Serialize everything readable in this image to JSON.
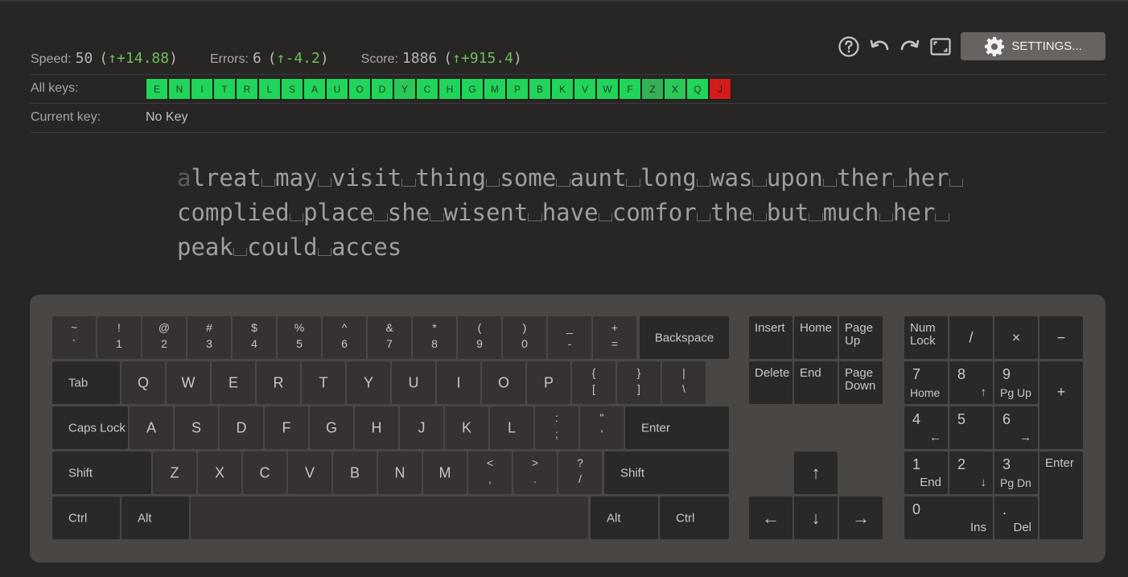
{
  "toolbar": {
    "settings_label": "SETTINGS..."
  },
  "stats": {
    "speed": {
      "label": "Speed:",
      "value": "50",
      "open": "(",
      "delta": "↑+14.88",
      "close": ")"
    },
    "errors": {
      "label": "Errors:",
      "value": "6",
      "open": "(",
      "delta": "↑-4.2",
      "close": ")"
    },
    "score": {
      "label": "Score:",
      "value": "1886",
      "open": "(",
      "delta": "↑+915.4",
      "close": ")"
    }
  },
  "all_keys": {
    "label": "All keys:",
    "keys": [
      {
        "k": "E",
        "color": "#21d45a"
      },
      {
        "k": "N",
        "color": "#21d45a"
      },
      {
        "k": "I",
        "color": "#21d45a"
      },
      {
        "k": "T",
        "color": "#21d45a"
      },
      {
        "k": "R",
        "color": "#21d45a"
      },
      {
        "k": "L",
        "color": "#21d45a"
      },
      {
        "k": "S",
        "color": "#21d45a"
      },
      {
        "k": "A",
        "color": "#21d45a"
      },
      {
        "k": "U",
        "color": "#21d45a"
      },
      {
        "k": "O",
        "color": "#21d45a"
      },
      {
        "k": "D",
        "color": "#21d45a"
      },
      {
        "k": "Y",
        "color": "#2bc757"
      },
      {
        "k": "C",
        "color": "#21d45a"
      },
      {
        "k": "H",
        "color": "#21d45a"
      },
      {
        "k": "G",
        "color": "#21d45a"
      },
      {
        "k": "M",
        "color": "#21d45a"
      },
      {
        "k": "P",
        "color": "#21d45a"
      },
      {
        "k": "B",
        "color": "#21d45a"
      },
      {
        "k": "K",
        "color": "#21d45a"
      },
      {
        "k": "V",
        "color": "#21d45a"
      },
      {
        "k": "W",
        "color": "#21d45a"
      },
      {
        "k": "F",
        "color": "#21d45a"
      },
      {
        "k": "Z",
        "color": "#34b055"
      },
      {
        "k": "X",
        "color": "#2bc757"
      },
      {
        "k": "Q",
        "color": "#21d45a"
      },
      {
        "k": "J",
        "color": "#d21c1c"
      }
    ]
  },
  "current_key": {
    "label": "Current key:",
    "value": "No Key"
  },
  "text": {
    "cursor_char": "a",
    "lines": [
      [
        "lreat",
        "may",
        "visit",
        "thing",
        "some",
        "aunt",
        "long",
        "was",
        "upon",
        "ther",
        "her",
        ""
      ],
      [
        "complied",
        "place",
        "she",
        "wisent",
        "have",
        "comfor",
        "the",
        "but",
        "much",
        "her",
        ""
      ],
      [
        "peak",
        "could",
        "acces"
      ]
    ]
  },
  "keyboard": {
    "row1": [
      [
        "~",
        "`"
      ],
      [
        "!",
        "1"
      ],
      [
        "@",
        "2"
      ],
      [
        "#",
        "3"
      ],
      [
        "$",
        "4"
      ],
      [
        "%",
        "5"
      ],
      [
        "^",
        "6"
      ],
      [
        "&",
        "7"
      ],
      [
        "*",
        "8"
      ],
      [
        "(",
        "9"
      ],
      [
        ")",
        "0"
      ],
      [
        "_",
        "-"
      ],
      [
        "+",
        "="
      ]
    ],
    "backspace": "Backspace",
    "tab": "Tab",
    "row2": [
      "Q",
      "W",
      "E",
      "R",
      "T",
      "Y",
      "U",
      "I",
      "O",
      "P"
    ],
    "row2_sym": [
      [
        "{",
        "["
      ],
      [
        "}",
        "]"
      ],
      [
        "|",
        "\\"
      ]
    ],
    "caps": "Caps Lock",
    "row3": [
      "A",
      "S",
      "D",
      "F",
      "G",
      "H",
      "J",
      "K",
      "L"
    ],
    "row3_sym": [
      [
        ":",
        ";"
      ],
      [
        "\"",
        "'"
      ]
    ],
    "enter": "Enter",
    "shift_left": "Shift",
    "row4": [
      "Z",
      "X",
      "C",
      "V",
      "B",
      "N",
      "M"
    ],
    "row4_sym": [
      [
        "<",
        ","
      ],
      [
        ">",
        "."
      ],
      [
        "?",
        "/"
      ]
    ],
    "shift_right": "Shift",
    "ctrl_left": "Ctrl",
    "alt_left": "Alt",
    "alt_right": "Alt",
    "ctrl_right": "Ctrl",
    "nav": {
      "insert": "Insert",
      "home": "Home",
      "page_up": "Page Up",
      "delete": "Delete",
      "end": "End",
      "page_down": "Page Down"
    },
    "arrows": {
      "up": "↑",
      "left": "←",
      "down": "↓",
      "right": "→"
    },
    "numpad": {
      "numlock": "Num Lock",
      "divide": "/",
      "multiply": "×",
      "minus": "−",
      "plus": "+",
      "n7": "7",
      "n7s": "Home",
      "n8": "8",
      "n8s": "↑",
      "n9": "9",
      "n9s": "Pg Up",
      "n4": "4",
      "n4s": "←",
      "n5": "5",
      "n6": "6",
      "n6s": "→",
      "n1": "1",
      "n1s": "End",
      "n2": "2",
      "n2s": "↓",
      "n3": "3",
      "n3s": "Pg Dn",
      "n0": "0",
      "n0s": "Ins",
      "dot": ".",
      "dots": "Del",
      "enter": "Enter"
    }
  }
}
